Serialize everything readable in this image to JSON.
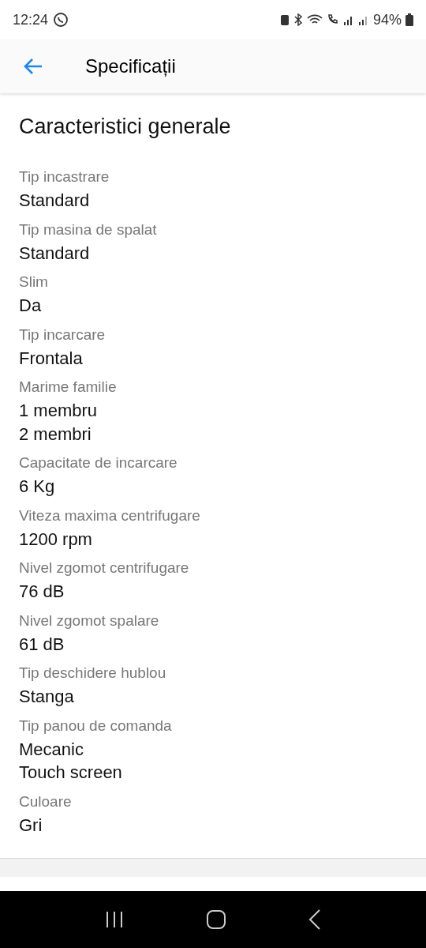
{
  "status_bar": {
    "time": "12:24",
    "battery": "94%"
  },
  "header": {
    "title": "Specificații"
  },
  "section": {
    "title": "Caracteristici generale",
    "specs": [
      {
        "label": "Tip incastrare",
        "values": [
          "Standard"
        ]
      },
      {
        "label": "Tip masina de spalat",
        "values": [
          "Standard"
        ]
      },
      {
        "label": "Slim",
        "values": [
          "Da"
        ]
      },
      {
        "label": "Tip incarcare",
        "values": [
          "Frontala"
        ]
      },
      {
        "label": "Marime familie",
        "values": [
          "1 membru",
          "2 membri"
        ]
      },
      {
        "label": "Capacitate de incarcare",
        "values": [
          "6 Kg"
        ]
      },
      {
        "label": "Viteza maxima centrifugare",
        "values": [
          "1200 rpm"
        ]
      },
      {
        "label": "Nivel zgomot centrifugare",
        "values": [
          "76 dB"
        ]
      },
      {
        "label": "Nivel zgomot spalare",
        "values": [
          "61 dB"
        ]
      },
      {
        "label": "Tip deschidere hublou",
        "values": [
          "Stanga"
        ]
      },
      {
        "label": "Tip panou de comanda",
        "values": [
          "Mecanic",
          "Touch screen"
        ]
      },
      {
        "label": "Culoare",
        "values": [
          "Gri"
        ]
      }
    ]
  }
}
